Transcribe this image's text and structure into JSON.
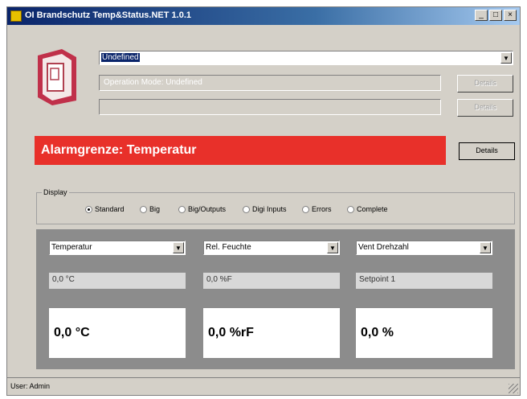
{
  "window": {
    "title": "OI Brandschutz Temp&Status.NET 1.0.1"
  },
  "selector": {
    "value": "Undefined"
  },
  "mode_field": "Operation Mode: Undefined",
  "buttons": {
    "details": "Details"
  },
  "alarm": {
    "text": "Alarmgrenze: Temperatur",
    "color": "#e8302a"
  },
  "display": {
    "legend": "Display",
    "options": [
      "Standard",
      "Big",
      "Big/Outputs",
      "Digi Inputs",
      "Errors",
      "Complete"
    ],
    "selected": "Standard"
  },
  "sensors": [
    {
      "select": "Temperatur",
      "reading": "0,0 °C",
      "value": "0,0 °C"
    },
    {
      "select": "Rel. Feuchte",
      "reading": "0,0 %F",
      "value": "0,0 %rF"
    },
    {
      "select": "Vent Drehzahl",
      "reading": "Setpoint 1",
      "value": "0,0 %"
    }
  ],
  "status": {
    "text": "User: Admin"
  }
}
